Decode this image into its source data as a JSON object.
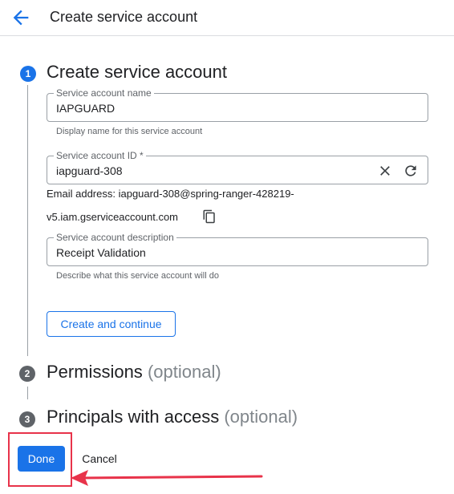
{
  "header": {
    "title": "Create service account",
    "back_icon": "arrow-back-icon"
  },
  "steps": [
    {
      "number": "1",
      "title": "Create service account",
      "optional": "",
      "state": "active"
    },
    {
      "number": "2",
      "title": "Permissions",
      "optional": "(optional)",
      "state": "inactive"
    },
    {
      "number": "3",
      "title": "Principals with access",
      "optional": "(optional)",
      "state": "inactive"
    }
  ],
  "form": {
    "name": {
      "label": "Service account name",
      "value": "IAPGUARD",
      "hint": "Display name for this service account"
    },
    "id": {
      "label": "Service account ID *",
      "value": "iapguard-308",
      "clear_icon": "close-icon",
      "refresh_icon": "refresh-icon"
    },
    "email": {
      "line1": "Email address: iapguard-308@spring-ranger-428219-",
      "line2": "v5.iam.gserviceaccount.com",
      "copy_icon": "copy-icon"
    },
    "description": {
      "label": "Service account description",
      "value": "Receipt Validation",
      "hint": "Describe what this service account will do"
    },
    "create_button": "Create and continue"
  },
  "footer": {
    "done_label": "Done",
    "cancel_label": "Cancel"
  },
  "colors": {
    "accent": "#1a73e8",
    "annotation": "#e8334a",
    "inactive_step": "#5f6368"
  }
}
